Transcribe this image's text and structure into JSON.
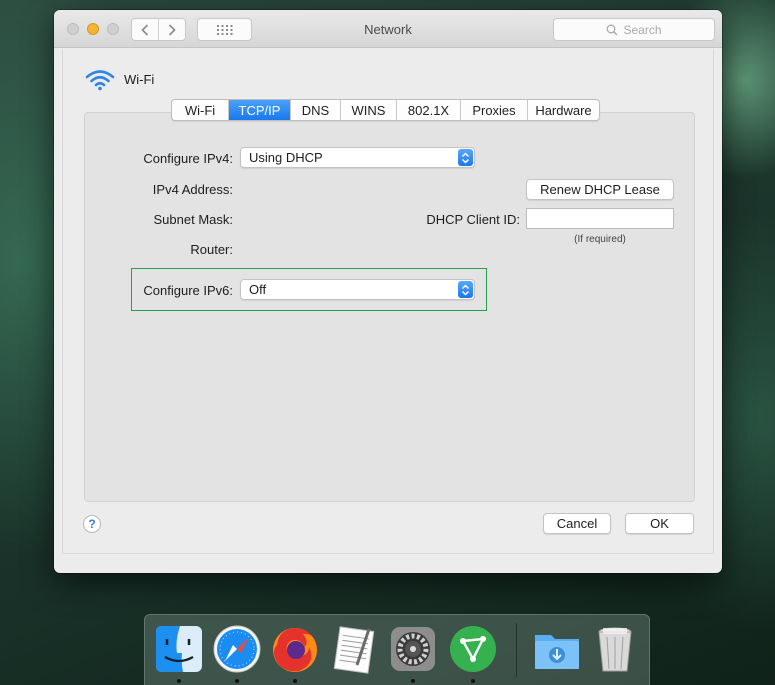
{
  "window": {
    "title": "Network",
    "search_placeholder": "Search"
  },
  "header": {
    "interface_name": "Wi-Fi"
  },
  "tabs": [
    {
      "label": "Wi-Fi",
      "active": false
    },
    {
      "label": "TCP/IP",
      "active": true
    },
    {
      "label": "DNS",
      "active": false
    },
    {
      "label": "WINS",
      "active": false
    },
    {
      "label": "802.1X",
      "active": false
    },
    {
      "label": "Proxies",
      "active": false
    },
    {
      "label": "Hardware",
      "active": false
    }
  ],
  "form": {
    "configure_ipv4_label": "Configure IPv4:",
    "configure_ipv4_value": "Using DHCP",
    "ipv4_address_label": "IPv4 Address:",
    "subnet_mask_label": "Subnet Mask:",
    "router_label": "Router:",
    "renew_button": "Renew DHCP Lease",
    "dhcp_client_id_label": "DHCP Client ID:",
    "dhcp_client_id_value": "",
    "if_required_note": "(If required)",
    "configure_ipv6_label": "Configure IPv6:",
    "configure_ipv6_value": "Off"
  },
  "footer": {
    "help": "?",
    "cancel_button": "Cancel",
    "ok_button": "OK"
  },
  "colors": {
    "accent_blue": "#1a78ef",
    "highlight_green": "#26a14b",
    "minimize_yellow": "#f5b431"
  },
  "dock": {
    "items": [
      {
        "icon": "finder-icon",
        "running": true
      },
      {
        "icon": "safari-icon",
        "running": true
      },
      {
        "icon": "firefox-icon",
        "running": true
      },
      {
        "icon": "textedit-icon",
        "running": false
      },
      {
        "icon": "system-preferences-icon",
        "running": true
      },
      {
        "icon": "vectorizer-app-icon",
        "running": true
      },
      {
        "icon": "downloads-folder-icon",
        "running": false
      },
      {
        "icon": "trash-icon",
        "running": false
      }
    ]
  }
}
